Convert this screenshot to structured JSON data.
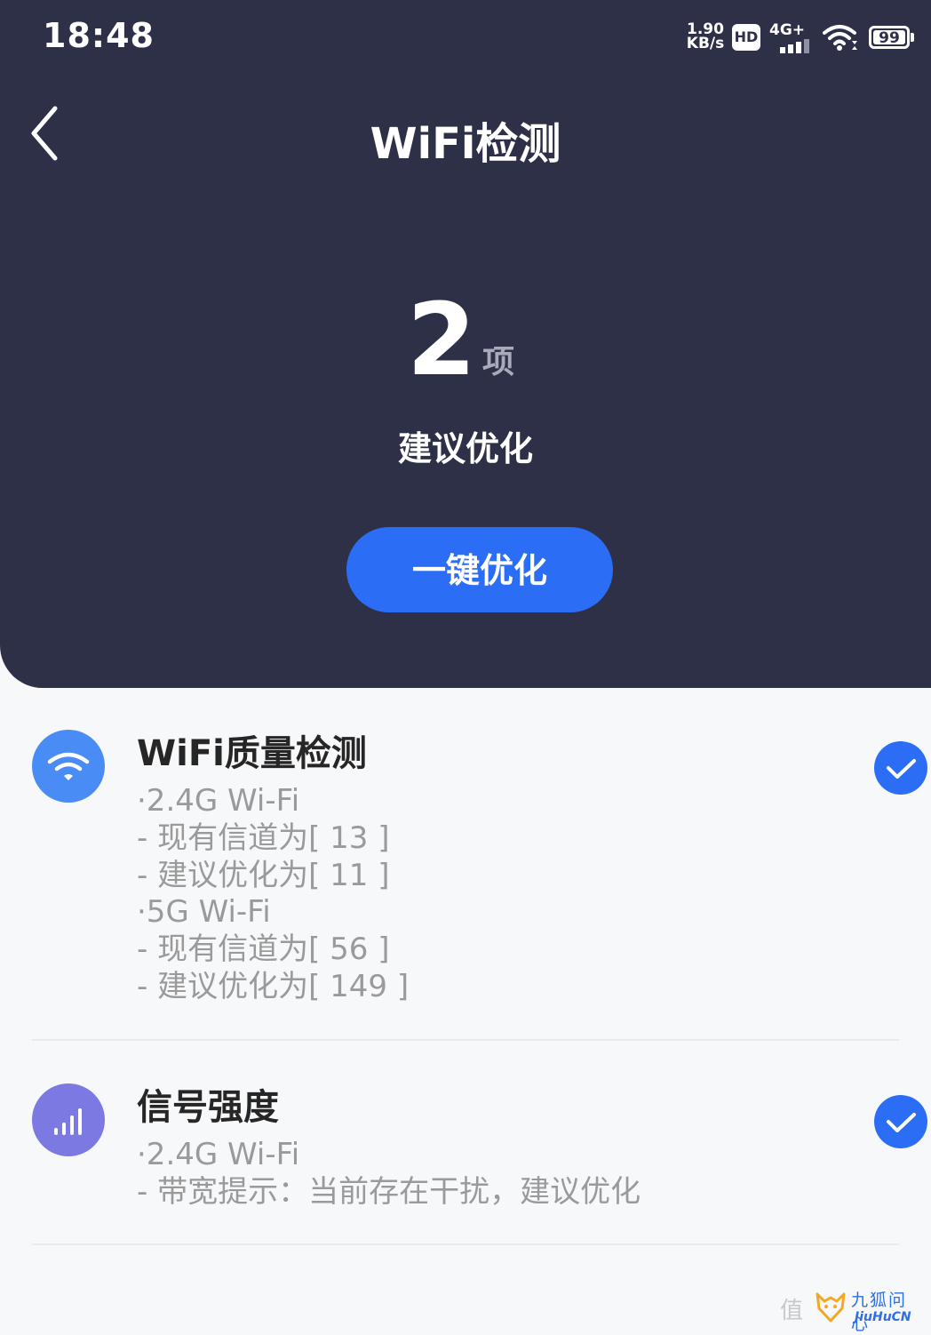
{
  "status_bar": {
    "time": "18:48",
    "net_speed_value": "1.90",
    "net_speed_unit": "KB/s",
    "hd_label": "HD",
    "network_label": "4G+",
    "battery_level": "99",
    "icons": [
      "signal-icon",
      "wifi-icon",
      "battery-icon"
    ]
  },
  "header": {
    "title": "WiFi检测",
    "back_icon": "chevron-left-icon"
  },
  "summary": {
    "count": "2",
    "unit": "项",
    "label": "建议优化",
    "button_label": "一键优化"
  },
  "items": [
    {
      "title": "WiFi质量检测",
      "icon": "wifi-icon",
      "lines": [
        "·2.4G  Wi-Fi",
        "- 现有信道为[ 13 ]",
        "- 建议优化为[ 11 ]",
        "·5G  Wi-Fi",
        "- 现有信道为[ 56 ]",
        "- 建议优化为[ 149 ]"
      ],
      "status_icon": "check-icon"
    },
    {
      "title": "信号强度",
      "icon": "signal-bars-icon",
      "lines": [
        "·2.4G  Wi-Fi",
        "- 带宽提示：当前存在干扰，建议优化"
      ],
      "status_icon": "check-icon"
    }
  ],
  "watermark": {
    "zhi": "值",
    "name": "九狐问心",
    "en": "JiuHuCN"
  },
  "colors": {
    "header_bg": "#2d3047",
    "accent_blue": "#2b6ef5",
    "wifi_icon_bg": "#4a8cf6",
    "signal_icon_bg": "#7d79e2",
    "page_bg": "#f7f8fa"
  }
}
